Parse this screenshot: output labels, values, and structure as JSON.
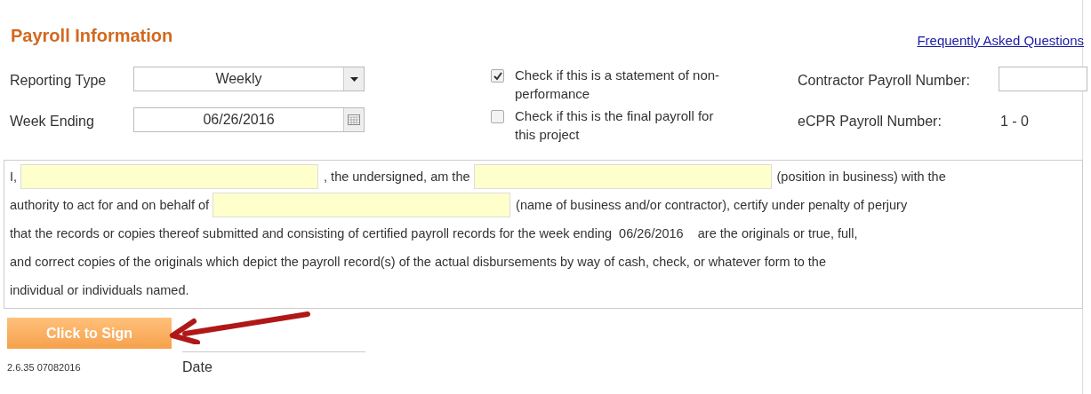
{
  "title": "Payroll Information",
  "faq_link": "Frequently Asked Questions",
  "reporting_type": {
    "label": "Reporting Type",
    "value": "Weekly"
  },
  "week_ending": {
    "label": "Week Ending",
    "value": "06/26/2016"
  },
  "checkboxes": [
    {
      "label": "Check if this is a statement of non-performance",
      "checked": true
    },
    {
      "label": "Check if this is the final payroll for this project",
      "checked": false
    }
  ],
  "contractor_payroll_number": {
    "label": "Contractor Payroll Number:"
  },
  "ecpr_payroll_number": {
    "label": "eCPR Payroll Number:",
    "value": "1 - 0"
  },
  "certification": [
    [
      {
        "kind": "text",
        "text": "I,"
      },
      {
        "kind": "field"
      },
      {
        "kind": "text",
        "text": ", the undersigned, am the"
      },
      {
        "kind": "field"
      },
      {
        "kind": "text",
        "text": "(position in business) with the"
      }
    ],
    [
      {
        "kind": "text",
        "text": "authority to act for and on behalf of"
      },
      {
        "kind": "field"
      },
      {
        "kind": "text",
        "text": "(name of business and/or contractor), certify under penalty of perjury"
      }
    ],
    [
      {
        "kind": "text",
        "text": "that the records or copies thereof submitted and consisting of certified payroll records for the week ending  06/26/2016    are the originals or true, full,"
      }
    ],
    [
      {
        "kind": "text",
        "text": "and correct copies of the originals which depict the payroll record(s) of the actual disbursements by way of cash, check, or whatever form to the"
      }
    ],
    [
      {
        "kind": "text",
        "text": "individual or individuals named."
      }
    ]
  ],
  "sign_button": "Click to Sign",
  "version": "2.6.35 07082016",
  "date_label": "Date"
}
